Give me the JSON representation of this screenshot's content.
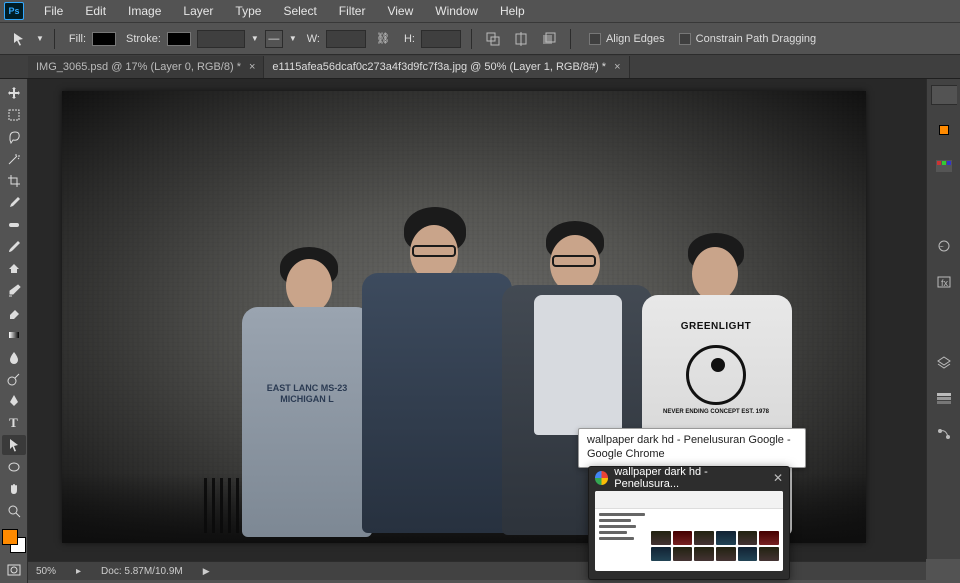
{
  "menubar": {
    "items": [
      "File",
      "Edit",
      "Image",
      "Layer",
      "Type",
      "Select",
      "Filter",
      "View",
      "Window",
      "Help"
    ]
  },
  "optbar": {
    "fill_label": "Fill:",
    "stroke_label": "Stroke:",
    "w_label": "W:",
    "h_label": "H:",
    "align_edges": "Align Edges",
    "constrain": "Constrain Path Dragging"
  },
  "tabs": [
    {
      "label": "IMG_3065.psd @ 17% (Layer 0, RGB/8) *"
    },
    {
      "label": "e1115afea56dcaf0c273a4f3d9fc7f3a.jpg @ 50% (Layer 1, RGB/8#) *"
    }
  ],
  "shirt": {
    "p1_lines": "EAST LANC\nMS-23\nMICHIGAN L",
    "p4_brand": "GREENLIGHT",
    "p4_sub": "NEVER ENDING CONCEPT\nEST. 1978"
  },
  "status": {
    "zoom": "50%",
    "doc": "Doc: 5.87M/10.9M"
  },
  "tooltip": {
    "text": "wallpaper dark hd - Penelusuran Google - Google Chrome"
  },
  "thumb": {
    "title": "wallpaper dark hd - Penelusura..."
  }
}
